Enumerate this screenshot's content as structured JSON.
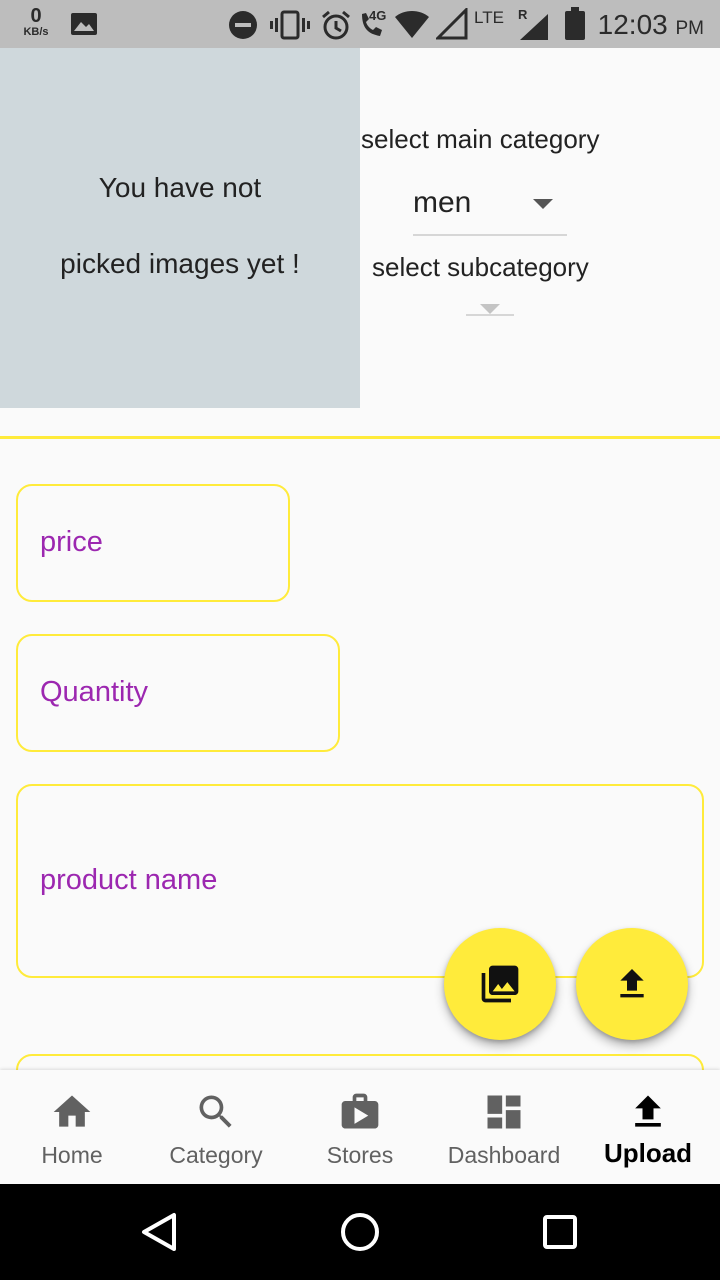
{
  "status_bar": {
    "net_speed_value": "0",
    "net_speed_unit": "KB/s",
    "network_label": "4G",
    "lte_label": "LTE",
    "roaming_label": "R",
    "time": "12:03",
    "ampm": "PM",
    "icons": [
      "image-icon",
      "dnd-icon",
      "vibrate-icon",
      "alarm-icon",
      "volte-call-icon",
      "wifi-icon",
      "signal-icon",
      "battery-icon"
    ]
  },
  "image_section": {
    "line1": "You have not",
    "line2": "picked images yet !",
    "background": "#cfd8dc"
  },
  "category": {
    "main_label": "select main category",
    "main_value": "men",
    "sub_label": "select subcategory",
    "sub_value": ""
  },
  "form": {
    "price_hint": "price",
    "quantity_hint": "Quantity",
    "product_name_hint": "product name",
    "border_color": "#ffeb3b",
    "hint_color": "#9c27b0"
  },
  "fabs": {
    "gallery_icon": "photo-library-icon",
    "upload_icon": "upload-icon",
    "color": "#ffeb3b"
  },
  "bottom_nav": {
    "items": [
      {
        "label": "Home",
        "icon": "home-icon",
        "active": false
      },
      {
        "label": "Category",
        "icon": "search-icon",
        "active": false
      },
      {
        "label": "Stores",
        "icon": "store-icon",
        "active": false
      },
      {
        "label": "Dashboard",
        "icon": "dashboard-icon",
        "active": false
      },
      {
        "label": "Upload",
        "icon": "upload-icon",
        "active": true
      }
    ]
  },
  "system_nav": {
    "icons": [
      "back-icon",
      "home-circle-icon",
      "recents-icon"
    ]
  }
}
